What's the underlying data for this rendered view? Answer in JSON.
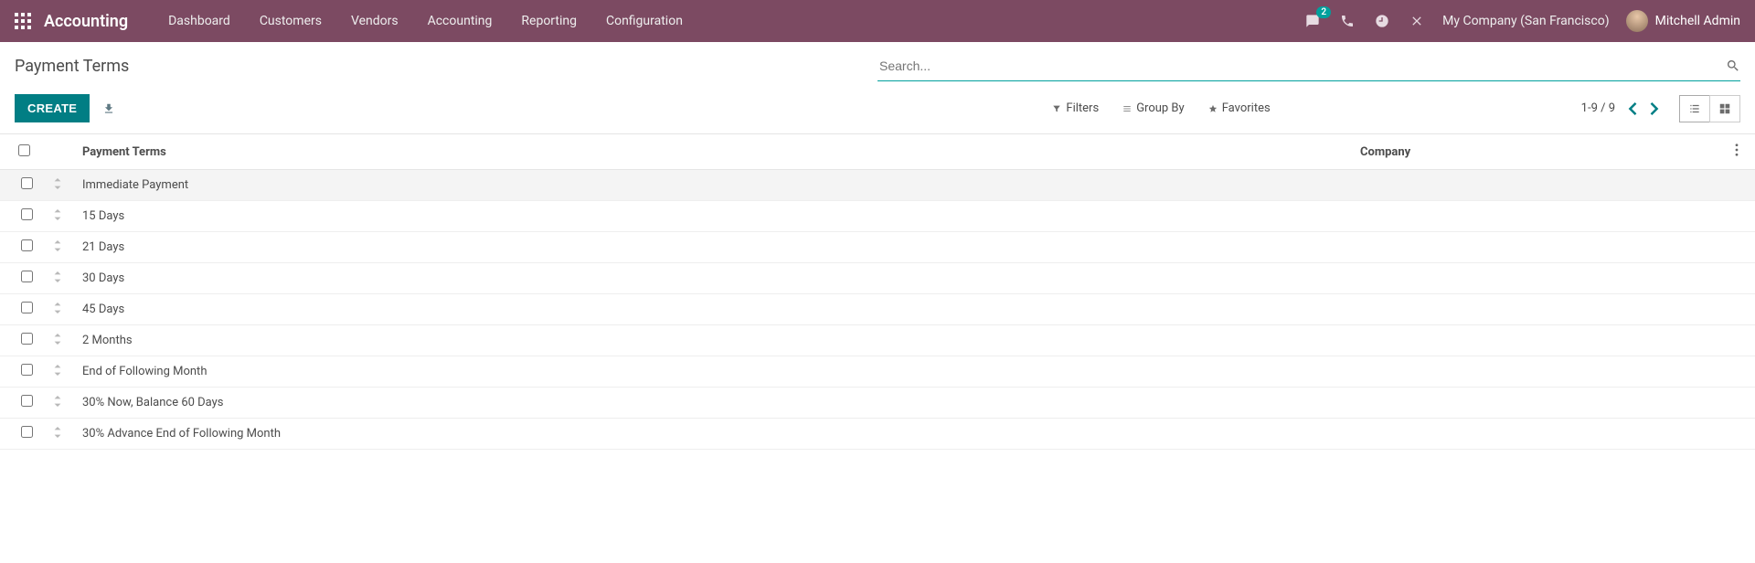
{
  "navbar": {
    "app_name": "Accounting",
    "menu": [
      "Dashboard",
      "Customers",
      "Vendors",
      "Accounting",
      "Reporting",
      "Configuration"
    ],
    "messages_badge": "2",
    "company": "My Company (San Francisco)",
    "user": "Mitchell Admin"
  },
  "breadcrumb": "Payment Terms",
  "search": {
    "placeholder": "Search..."
  },
  "toolbar": {
    "create": "CREATE",
    "filters": "Filters",
    "groupby": "Group By",
    "favorites": "Favorites",
    "pager": "1-9 / 9"
  },
  "table": {
    "headers": {
      "name": "Payment Terms",
      "company": "Company"
    },
    "rows": [
      {
        "name": "Immediate Payment",
        "company": ""
      },
      {
        "name": "15 Days",
        "company": ""
      },
      {
        "name": "21 Days",
        "company": ""
      },
      {
        "name": "30 Days",
        "company": ""
      },
      {
        "name": "45 Days",
        "company": ""
      },
      {
        "name": "2 Months",
        "company": ""
      },
      {
        "name": "End of Following Month",
        "company": ""
      },
      {
        "name": "30% Now, Balance 60 Days",
        "company": ""
      },
      {
        "name": "30% Advance End of Following Month",
        "company": ""
      }
    ]
  }
}
